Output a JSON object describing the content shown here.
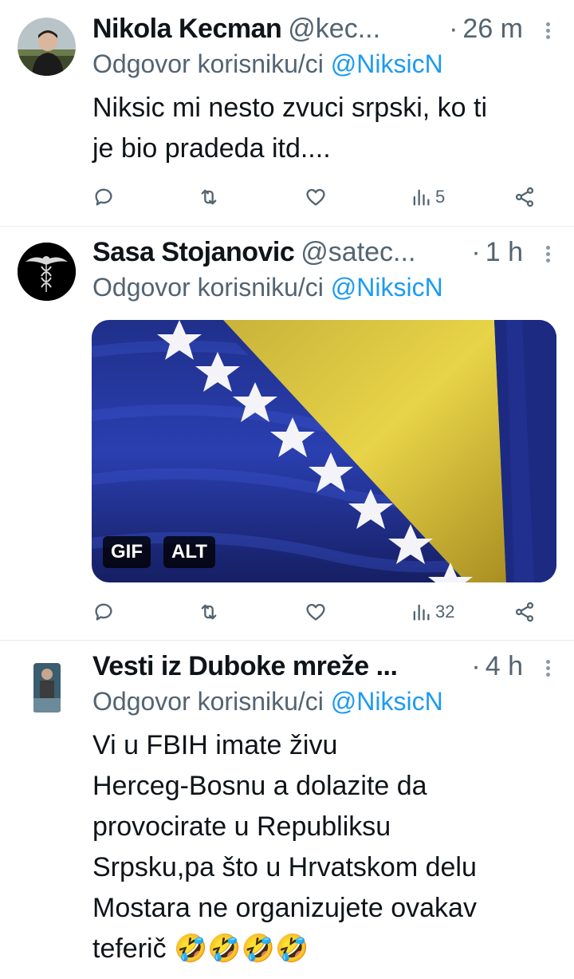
{
  "tweets": [
    {
      "name": "Nikola Kecman",
      "handle": "@kec...",
      "dot": "·",
      "time": "26 m",
      "reply_prefix": "Odgovor korisniku/ci",
      "reply_mention": "@NiksicN",
      "text_lines": [
        "Niksic mi nesto zvuci srpski, ko ti",
        "je bio pradeda itd...."
      ],
      "views": "5"
    },
    {
      "name": "Sasa Stojanovic",
      "handle": "@satec...",
      "dot": "·",
      "time": "1 h",
      "reply_prefix": "Odgovor korisniku/ci",
      "reply_mention": "@NiksicN",
      "media": {
        "badges": [
          "GIF",
          "ALT"
        ]
      },
      "views": "32"
    },
    {
      "name": "Vesti iz Duboke mreže ...",
      "handle": "",
      "dot": "·",
      "time": "4 h",
      "reply_prefix": "Odgovor korisniku/ci",
      "reply_mention": "@NiksicN",
      "text_lines": [
        "Vi u FBIH imate živu",
        "Herceg-Bosnu a dolazite da",
        "provocirate u Republiksu",
        "Srpsku,pa što u Hrvatskom delu",
        "Mostara ne organizujete ovakav",
        "teferič 🤣🤣🤣🤣"
      ]
    }
  ],
  "icons": {
    "reply": "reply-icon",
    "retweet": "retweet-icon",
    "like": "like-icon",
    "views": "views-icon",
    "share": "share-icon",
    "more": "more-icon"
  },
  "colors": {
    "link": "#1d9bf0",
    "secondary": "#536471",
    "divider": "#e6ecf0"
  }
}
